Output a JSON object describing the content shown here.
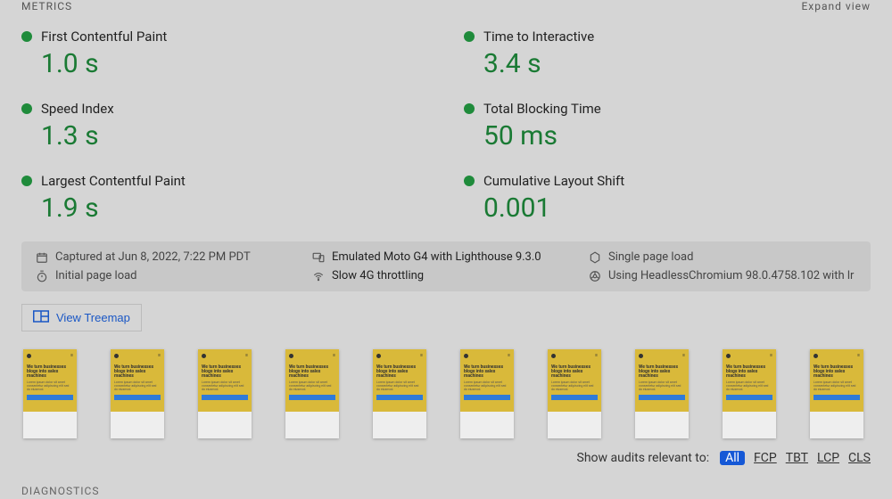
{
  "section": {
    "title": "METRICS",
    "expand": "Expand view"
  },
  "metrics": [
    {
      "name": "First Contentful Paint",
      "value": "1.0 s"
    },
    {
      "name": "Time to Interactive",
      "value": "3.4 s"
    },
    {
      "name": "Speed Index",
      "value": "1.3 s"
    },
    {
      "name": "Total Blocking Time",
      "value": "50 ms"
    },
    {
      "name": "Largest Contentful Paint",
      "value": "1.9 s"
    },
    {
      "name": "Cumulative Layout Shift",
      "value": "0.001"
    }
  ],
  "env": {
    "captured": "Captured at Jun 8, 2022, 7:22 PM PDT",
    "device": "Emulated Moto G4 with Lighthouse 9.3.0",
    "pageload": "Single page load",
    "initial": "Initial page load",
    "throttle": "Slow 4G throttling",
    "browser": "Using HeadlessChromium 98.0.4758.102 with lr"
  },
  "treemap": {
    "label": "View Treemap"
  },
  "frame": {
    "title": "We turn businesses blogs into sales machines",
    "sub": "Lorem ipsum dolor sit amet consectetur adipiscing elit sed do eiusmod."
  },
  "auditFilter": {
    "label": "Show audits relevant to:",
    "options": [
      "All",
      "FCP",
      "TBT",
      "LCP",
      "CLS"
    ]
  },
  "diagnostics": {
    "title": "DIAGNOSTICS"
  }
}
